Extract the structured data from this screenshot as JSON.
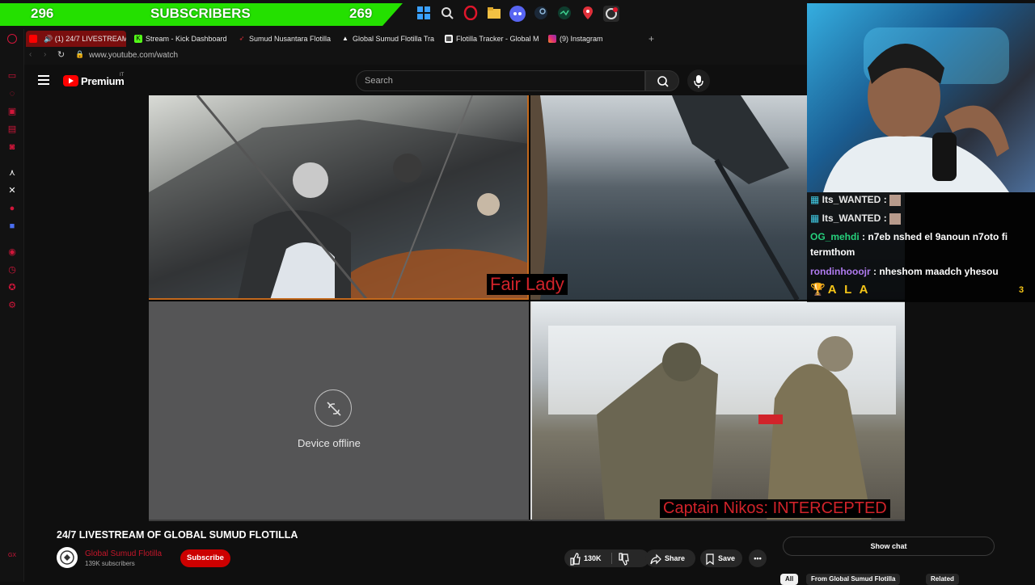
{
  "overlay": {
    "left_count": "296",
    "center_label": "SUBSCRIBERS",
    "right_count": "269"
  },
  "tabs": [
    {
      "label": "(1) 24/7 LIVESTREAM",
      "icon": "youtube-icon"
    },
    {
      "label": "Stream - Kick Dashboard",
      "icon": "kick-icon"
    },
    {
      "label": "Sumud Nusantara Flotilla",
      "icon": "sumud-icon"
    },
    {
      "label": "Global Sumud Flotilla Tra",
      "icon": "flotilla-icon"
    },
    {
      "label": "Flotilla Tracker - Global M",
      "icon": "tracker-icon"
    },
    {
      "label": "(9) Instagram",
      "icon": "instagram-icon"
    }
  ],
  "address": {
    "url": "www.youtube.com/watch"
  },
  "youtube": {
    "logo_text": "Premium",
    "region": "IT",
    "search_placeholder": "Search"
  },
  "video": {
    "q2_label": "Fair Lady",
    "q3_status": "Device offline",
    "q4_label": "Captain Nikos: INTERCEPTED"
  },
  "chat": {
    "messages": [
      {
        "user": "Its_WANTED",
        "text": "",
        "color": "#e8e8e8"
      },
      {
        "user": "Its_WANTED",
        "text": "",
        "color": "#e8e8e8"
      },
      {
        "user": "OG_mehdi",
        "text": "n7eb nshed el 9anoun n7oto fi termthom",
        "color": "#26d07c"
      },
      {
        "user": "rondinhooojr",
        "text": "nheshom maadch yhesou",
        "color": "#b07bf0"
      }
    ],
    "pinned_name": "A L A",
    "pinned_count": "3"
  },
  "info": {
    "title": "24/7 LIVESTREAM OF GLOBAL SUMUD FLOTILLA",
    "channel": "Global Sumud Flotilla",
    "subscribers": "139K subscribers",
    "subscribe_label": "Subscribe",
    "likes": "130K",
    "share_label": "Share",
    "save_label": "Save",
    "show_chat_label": "Show chat",
    "chips": [
      "All",
      "From Global Sumud Flotilla",
      "Related"
    ]
  },
  "colors": {
    "accent_green": "#24e000",
    "yt_red": "#ff0000",
    "opera_red": "#d0163a"
  }
}
